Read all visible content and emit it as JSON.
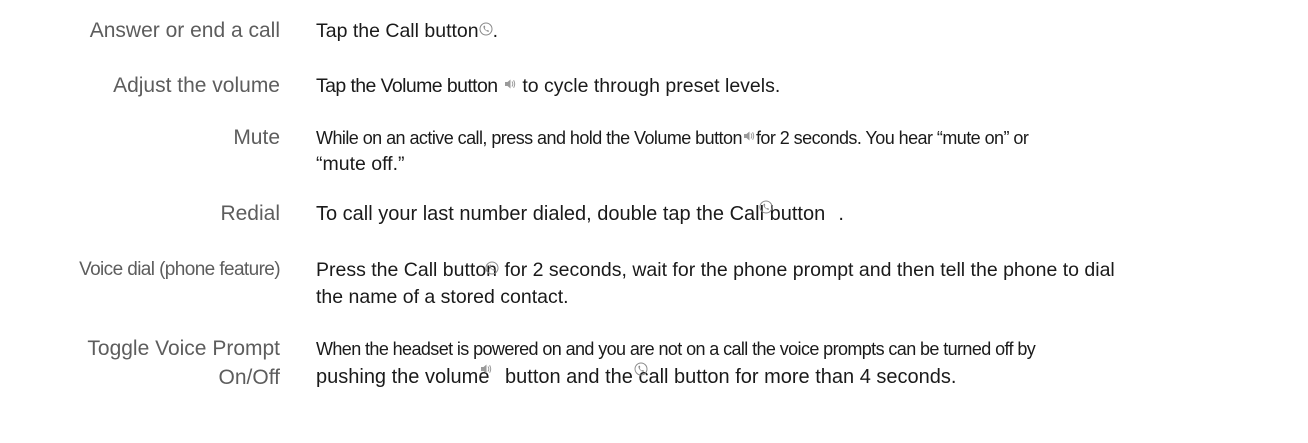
{
  "rows": [
    {
      "label": "Answer or end a call",
      "parts": [
        "Tap the Call button",
        "."
      ]
    },
    {
      "label": "Adjust the volume",
      "parts": [
        "Tap the Volume button",
        "to cycle through preset levels."
      ]
    },
    {
      "label": "Mute",
      "line1": [
        "While on an active call, press and hold the Volume button",
        "for 2 seconds. You hear “mute on” or"
      ],
      "line2": "“mute off.”"
    },
    {
      "label": "Redial",
      "parts": [
        "To call your last number dialed, double tap the Call button",
        "."
      ]
    },
    {
      "label": "Voice dial (phone feature)",
      "line1": [
        "Press the Call button",
        "for 2 seconds, wait for the phone prompt and then tell the phone to dial"
      ],
      "line2": "the name of a stored contact."
    },
    {
      "label_line1": "Toggle Voice Prompt",
      "label_line2": "On/Off",
      "line1": "When the headset is powered on and you are not on a call the voice prompts can be turned off by",
      "line2": [
        "pushing the volume",
        "button and the call",
        "button for more than 4 seconds."
      ]
    }
  ],
  "icons": {
    "call": "call-button-icon",
    "volume": "volume-button-icon"
  }
}
